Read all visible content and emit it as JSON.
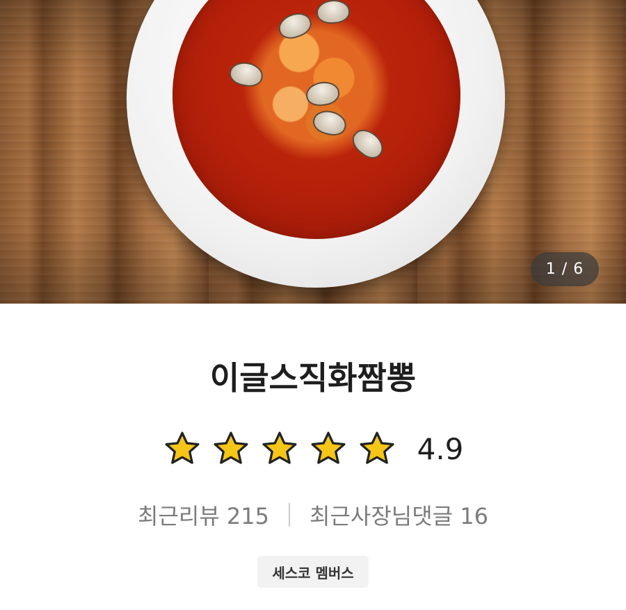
{
  "gallery": {
    "current_page": "1",
    "total_pages": "6",
    "counter_text": "1 / 6"
  },
  "store": {
    "name": "이글스직화짬뽕",
    "rating_value": "4.9",
    "stars_filled": 5,
    "stars_total": 5,
    "recent_reviews_label": "최근리뷰 215",
    "recent_owner_comments_label": "최근사장님댓글 16",
    "badge_label": "세스코 멤버스"
  },
  "colors": {
    "star_fill": "#f5c518",
    "star_outline": "#222222",
    "text_primary": "#1e1e1e",
    "text_secondary": "#7b7b7b",
    "badge_bg": "#f2f2f2"
  },
  "icons": [
    "star-icon"
  ]
}
